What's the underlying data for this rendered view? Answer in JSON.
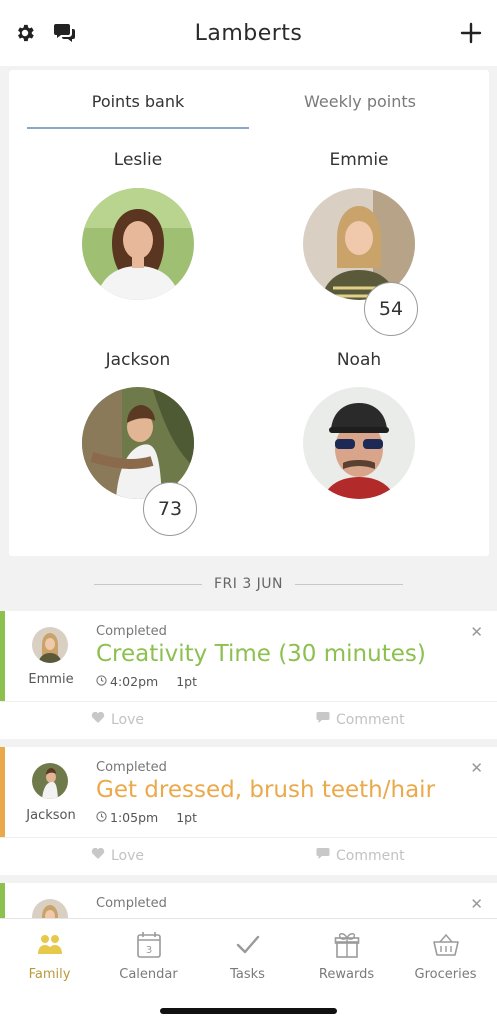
{
  "header": {
    "title": "Lamberts",
    "left_icons": [
      "gear-icon",
      "chat-bubbles-icon"
    ],
    "right_icon": "plus-icon"
  },
  "points_card": {
    "tabs": [
      {
        "label": "Points bank",
        "active": true
      },
      {
        "label": "Weekly points",
        "active": false
      }
    ],
    "people": [
      {
        "name": "Leslie",
        "points": null
      },
      {
        "name": "Emmie",
        "points": "54"
      },
      {
        "name": "Jackson",
        "points": "73"
      },
      {
        "name": "Noah",
        "points": null
      }
    ]
  },
  "feed": {
    "date_label": "FRI 3 JUN",
    "items": [
      {
        "person": "Emmie",
        "status": "Completed",
        "task": "Creativity Time (30 minutes)",
        "time": "4:02pm",
        "points": "1pt",
        "accent": "#8cc04f",
        "love": "Love",
        "comment": "Comment"
      },
      {
        "person": "Jackson",
        "status": "Completed",
        "task": "Get dressed, brush teeth/hair",
        "time": "1:05pm",
        "points": "1pt",
        "accent": "#eaa94b",
        "love": "Love",
        "comment": "Comment"
      },
      {
        "person": "",
        "status": "Completed",
        "task": "",
        "time": "",
        "points": "",
        "accent": "#8cc04f",
        "love": "",
        "comment": ""
      }
    ]
  },
  "bottom_nav": {
    "items": [
      {
        "label": "Family",
        "icon": "family-icon",
        "active": true
      },
      {
        "label": "Calendar",
        "icon": "calendar-icon",
        "active": false,
        "badge": "3"
      },
      {
        "label": "Tasks",
        "icon": "checkmark-icon",
        "active": false
      },
      {
        "label": "Rewards",
        "icon": "gift-icon",
        "active": false
      },
      {
        "label": "Groceries",
        "icon": "basket-icon",
        "active": false
      }
    ]
  },
  "colors": {
    "accent_active_nav": "#b89a3c",
    "tab_underline": "#8aa7c9"
  }
}
